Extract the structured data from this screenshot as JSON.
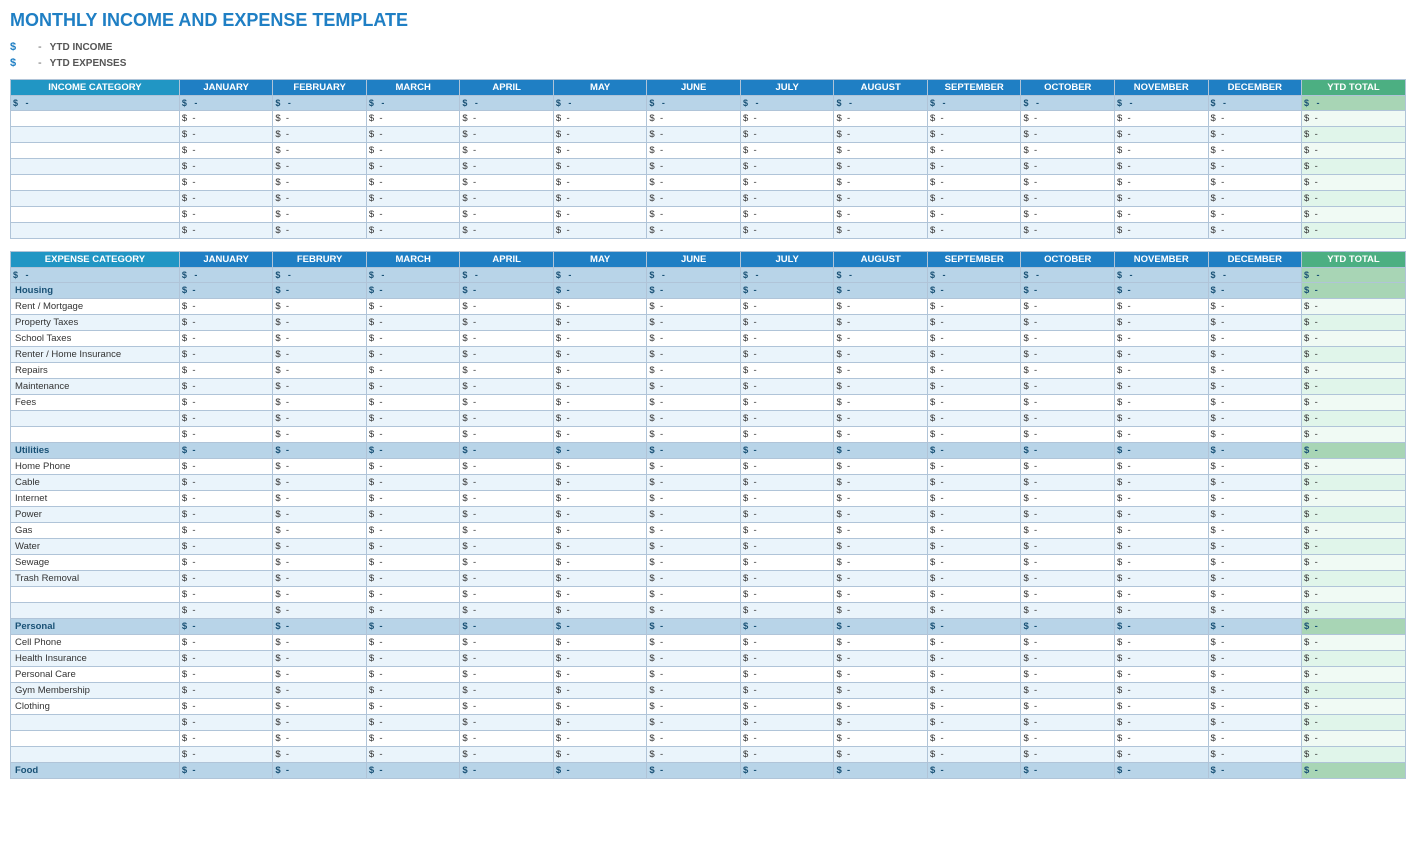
{
  "title": "MONTHLY INCOME AND EXPENSE TEMPLATE",
  "summary": {
    "ytd_income_label": "YTD INCOME",
    "ytd_expenses_label": "YTD EXPENSES",
    "dollar_sign": "$",
    "dash": "-"
  },
  "months": [
    "JANUARY",
    "FEBRUARY",
    "MARCH",
    "APRIL",
    "MAY",
    "JUNE",
    "JULY",
    "AUGUST",
    "SEPTEMBER",
    "OCTOBER",
    "NOVEMBER",
    "DECEMBER"
  ],
  "months_expense": [
    "JANUARY",
    "FEBRURY",
    "MARCH",
    "APRIL",
    "MAY",
    "JUNE",
    "JULY",
    "AUGUST",
    "SEPTEMBER",
    "OCTOBER",
    "NOVEMBER",
    "DECEMBER"
  ],
  "ytd_total": "YTD TOTAL",
  "income_category_label": "INCOME CATEGORY",
  "expense_category_label": "EXPENSE CATEGORY",
  "income_rows": 8,
  "expense_sections": [
    {
      "name": "Housing",
      "items": [
        "Rent / Mortgage",
        "Property Taxes",
        "School Taxes",
        "Renter / Home Insurance",
        "Repairs",
        "Maintenance",
        "Fees",
        "",
        ""
      ]
    },
    {
      "name": "Utilities",
      "items": [
        "Home Phone",
        "Cable",
        "Internet",
        "Power",
        "Gas",
        "Water",
        "Sewage",
        "Trash Removal",
        "",
        ""
      ]
    },
    {
      "name": "Personal",
      "items": [
        "Cell Phone",
        "Health Insurance",
        "Personal Care",
        "Gym Membership",
        "Clothing",
        "",
        "",
        ""
      ]
    },
    {
      "name": "Food",
      "items": []
    }
  ]
}
